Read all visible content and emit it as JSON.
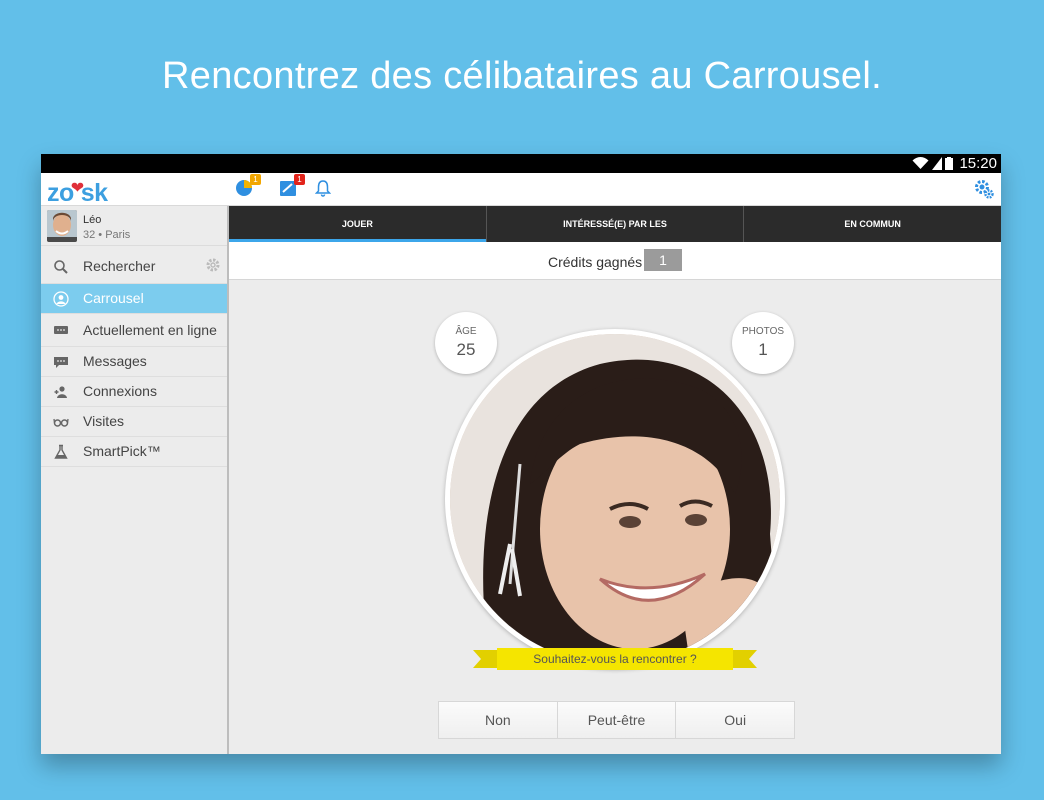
{
  "headline": "Rencontrez des célibataires au Carrousel.",
  "status_bar": {
    "time": "15:20"
  },
  "app": {
    "logo_text_left": "zo",
    "logo_text_right": "sk",
    "notification_badges": {
      "first": "1",
      "second": "1"
    }
  },
  "profile": {
    "name": "Léo",
    "meta": "32 • Paris"
  },
  "sidebar": {
    "search_label": "Rechercher",
    "items": [
      {
        "label": "Carrousel",
        "icon": "carousel-icon",
        "active": true
      },
      {
        "label": "Actuellement en ligne",
        "icon": "online-chat-icon",
        "active": false
      },
      {
        "label": "Messages",
        "icon": "messages-icon",
        "active": false
      },
      {
        "label": "Connexions",
        "icon": "connections-icon",
        "active": false
      },
      {
        "label": "Visites",
        "icon": "glasses-icon",
        "active": false
      },
      {
        "label": "SmartPick™",
        "icon": "flask-icon",
        "active": false
      }
    ]
  },
  "tabs": [
    {
      "label": "JOUER",
      "active": true
    },
    {
      "label": "INTÉRESSÉ(E) PAR LES",
      "active": false
    },
    {
      "label": "EN COMMUN",
      "active": false
    }
  ],
  "credits": {
    "label": "Crédits gagnés",
    "value": "1"
  },
  "card": {
    "age_label": "ÂGE",
    "age_value": "25",
    "photos_label": "PHOTOS",
    "photos_value": "1",
    "question": "Souhaitez-vous la rencontrer ?"
  },
  "choices": {
    "no": "Non",
    "maybe": "Peut-être",
    "yes": "Oui"
  },
  "colors": {
    "background": "#62bfe9",
    "accent": "#3ca6ea",
    "active_item": "#7cccee",
    "ribbon": "#f5e500",
    "dark_tabs": "#2b2b2b"
  }
}
